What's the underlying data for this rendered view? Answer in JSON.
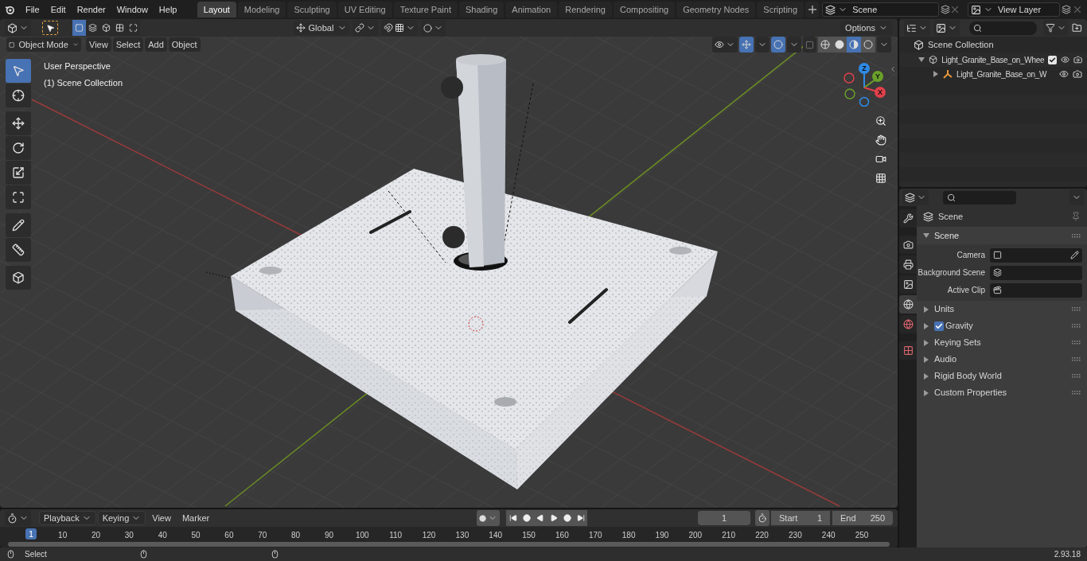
{
  "menu": [
    "File",
    "Edit",
    "Render",
    "Window",
    "Help"
  ],
  "workspaces": [
    {
      "label": "Layout",
      "selected": true
    },
    {
      "label": "Modeling",
      "selected": false
    },
    {
      "label": "Sculpting",
      "selected": false
    },
    {
      "label": "UV Editing",
      "selected": false
    },
    {
      "label": "Texture Paint",
      "selected": false
    },
    {
      "label": "Shading",
      "selected": false
    },
    {
      "label": "Animation",
      "selected": false
    },
    {
      "label": "Rendering",
      "selected": false
    },
    {
      "label": "Compositing",
      "selected": false
    },
    {
      "label": "Geometry Nodes",
      "selected": false
    },
    {
      "label": "Scripting",
      "selected": false
    }
  ],
  "scene_selector": "Scene",
  "view_layer": "View Layer",
  "viewport": {
    "select_modes": [
      {
        "selected": true
      },
      {
        "selected": false
      },
      {
        "selected": false
      },
      {
        "selected": false
      },
      {
        "selected": false
      }
    ],
    "orientation": "Global",
    "options": "Options",
    "mode": "Object Mode",
    "menus": [
      "View",
      "Select",
      "Add",
      "Object"
    ],
    "shading_modes": [
      {
        "selected": false
      },
      {
        "selected": false
      },
      {
        "selected": true
      },
      {
        "selected": false
      }
    ],
    "overlay_text": [
      "User Perspective",
      "(1) Scene Collection"
    ],
    "tools": [
      {
        "selected": true
      },
      {
        "selected": false
      },
      {
        "selected": false
      },
      {
        "selected": false
      },
      {
        "selected": false
      },
      {
        "selected": false
      },
      {
        "selected": false
      },
      {
        "selected": false
      },
      {
        "selected": false
      }
    ],
    "gizmo_axes": [
      "Z",
      "Y",
      "X"
    ]
  },
  "outliner": {
    "root": "Scene Collection",
    "items": [
      {
        "label": "Light_Granite_Base_on_Whee",
        "expanded": true,
        "checked": true,
        "children": [
          {
            "label": "Light_Granite_Base_on_W",
            "expanded": false
          }
        ]
      }
    ]
  },
  "properties": {
    "tabs": [
      {
        "selected": false
      },
      {
        "selected": false
      },
      {
        "selected": false
      },
      {
        "selected": false
      },
      {
        "selected": true
      },
      {
        "selected": false
      },
      {
        "selected": false
      }
    ],
    "context": "Scene",
    "panel": {
      "title": "Scene",
      "expanded": true,
      "fields": [
        "Camera",
        "Background Scene",
        "Active Clip"
      ]
    },
    "sections": [
      {
        "label": "Units",
        "kind": "plain"
      },
      {
        "label": "Gravity",
        "kind": "checkbox",
        "checked": true
      },
      {
        "label": "Keying Sets",
        "kind": "plain"
      },
      {
        "label": "Audio",
        "kind": "plain"
      },
      {
        "label": "Rigid Body World",
        "kind": "plain"
      },
      {
        "label": "Custom Properties",
        "kind": "plain"
      }
    ]
  },
  "timeline": {
    "menus": [
      {
        "label": "Playback",
        "dropdown": true
      },
      {
        "label": "Keying",
        "dropdown": true
      },
      {
        "label": "View",
        "dropdown": false
      },
      {
        "label": "Marker",
        "dropdown": false
      }
    ],
    "current_frame": "1",
    "start_label": "Start",
    "start": "1",
    "end_label": "End",
    "end": "250",
    "playhead": "1",
    "ruler": [
      "10",
      "20",
      "30",
      "40",
      "50",
      "60",
      "70",
      "80",
      "90",
      "100",
      "110",
      "120",
      "130",
      "140",
      "150",
      "160",
      "170",
      "180",
      "190",
      "200",
      "210",
      "220",
      "230",
      "240",
      "250"
    ]
  },
  "status_bar": {
    "action": "Select",
    "version": "2.93.18"
  }
}
